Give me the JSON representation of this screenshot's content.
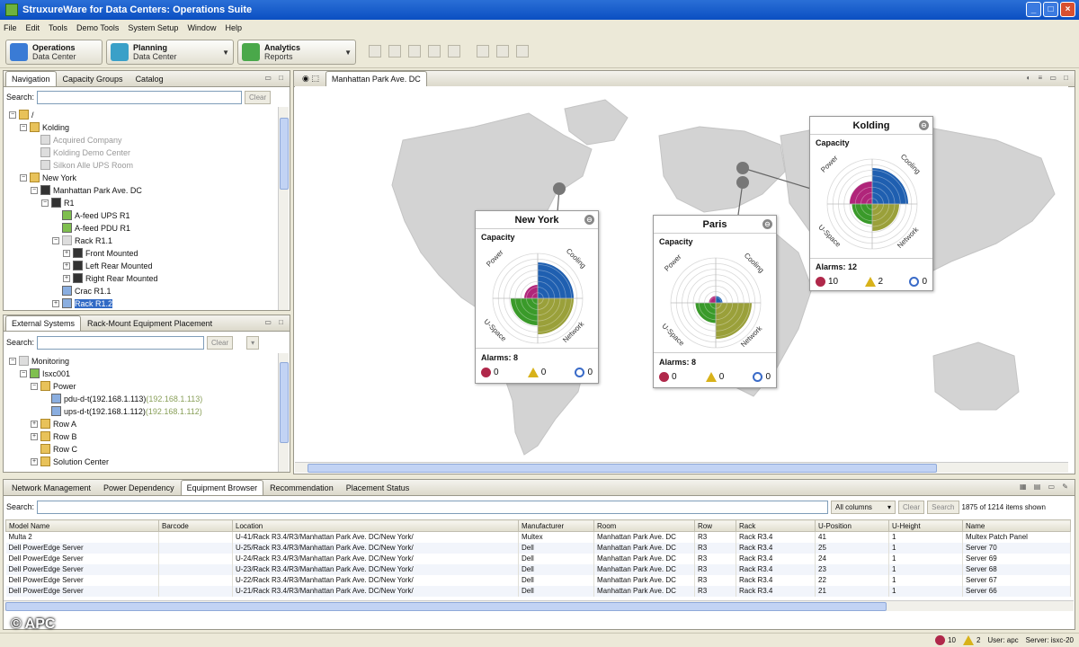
{
  "window": {
    "title": "StruxureWare for Data Centers: Operations Suite"
  },
  "menu": [
    "File",
    "Edit",
    "Tools",
    "Demo Tools",
    "System Setup",
    "Window",
    "Help"
  ],
  "perspectives": [
    {
      "title": "Operations",
      "sub": "Data Center",
      "color": "#3a7bd5"
    },
    {
      "title": "Planning",
      "sub": "Data Center",
      "color": "#3aa0c8"
    },
    {
      "title": "Analytics",
      "sub": "Reports",
      "color": "#4aa84a"
    }
  ],
  "navigation": {
    "tabs": [
      "Navigation",
      "Capacity Groups",
      "Catalog"
    ],
    "search_label": "Search:",
    "clear_label": "Clear",
    "tree": [
      {
        "label": "/",
        "indent": 0,
        "icon": "folder",
        "exp": "−"
      },
      {
        "label": "Kolding",
        "indent": 1,
        "icon": "folder",
        "exp": "−"
      },
      {
        "label": "Acquired Company",
        "indent": 2,
        "icon": "gray",
        "grey": true
      },
      {
        "label": "Kolding Demo Center",
        "indent": 2,
        "icon": "gray",
        "grey": true
      },
      {
        "label": "Silkon Alle UPS Room",
        "indent": 2,
        "icon": "gray",
        "grey": true
      },
      {
        "label": "New York",
        "indent": 1,
        "icon": "folder",
        "exp": "−"
      },
      {
        "label": "Manhattan Park Ave. DC",
        "indent": 2,
        "icon": "dark",
        "exp": "−"
      },
      {
        "label": "R1",
        "indent": 3,
        "icon": "dark",
        "exp": "−"
      },
      {
        "label": "A-feed UPS R1",
        "indent": 4,
        "icon": "green"
      },
      {
        "label": "A-feed PDU R1",
        "indent": 4,
        "icon": "green"
      },
      {
        "label": "Rack R1.1",
        "indent": 4,
        "icon": "gray",
        "exp": "−"
      },
      {
        "label": "Front Mounted",
        "indent": 5,
        "icon": "dark",
        "exp": "+"
      },
      {
        "label": "Left Rear Mounted",
        "indent": 5,
        "icon": "dark",
        "exp": "+"
      },
      {
        "label": "Right Rear Mounted",
        "indent": 5,
        "icon": "dark",
        "exp": "+"
      },
      {
        "label": "Crac R1.1",
        "indent": 4,
        "icon": "blue"
      },
      {
        "label": "Rack R1.2",
        "indent": 4,
        "icon": "blue",
        "sel": true,
        "exp": "+"
      }
    ]
  },
  "external": {
    "tabs": [
      "External Systems",
      "Rack-Mount Equipment Placement"
    ],
    "search_label": "Search:",
    "clear_label": "Clear",
    "tree": [
      {
        "label": "Monitoring",
        "indent": 0,
        "icon": "gray",
        "exp": "−"
      },
      {
        "label": "Isxc001",
        "indent": 1,
        "icon": "green",
        "exp": "−"
      },
      {
        "label": "Power",
        "indent": 2,
        "icon": "folder",
        "exp": "−"
      },
      {
        "label": "pdu-d-t(192.168.1.113)",
        "extra": "(192.168.1.113)",
        "indent": 3,
        "icon": "blue"
      },
      {
        "label": "ups-d-t(192.168.1.112)",
        "extra": "(192.168.1.112)",
        "indent": 3,
        "icon": "blue"
      },
      {
        "label": "Row A",
        "indent": 2,
        "icon": "folder",
        "exp": "+"
      },
      {
        "label": "Row B",
        "indent": 2,
        "icon": "folder",
        "exp": "+"
      },
      {
        "label": "Row C",
        "indent": 2,
        "icon": "folder"
      },
      {
        "label": "Solution Center",
        "indent": 2,
        "icon": "folder",
        "exp": "+"
      }
    ]
  },
  "editor": {
    "tab": "Manhattan Park Ave. DC"
  },
  "sites": [
    {
      "name": "New York",
      "capacity_label": "Capacity",
      "alarms_label": "Alarms: 8",
      "critical": "0",
      "warning": "0",
      "info": "0",
      "axes": {
        "tl": "Power",
        "tr": "Cooling",
        "bl": "U-Space",
        "br": "Network"
      },
      "cap": {
        "power": 0.3,
        "cooling": 0.8,
        "uspace": 0.6,
        "network": 0.8
      }
    },
    {
      "name": "Paris",
      "capacity_label": "Capacity",
      "alarms_label": "Alarms: 8",
      "critical": "0",
      "warning": "0",
      "info": "0",
      "axes": {
        "tl": "Power",
        "tr": "Cooling",
        "bl": "U-Space",
        "br": "Network"
      },
      "cap": {
        "power": 0.15,
        "cooling": 0.15,
        "uspace": 0.45,
        "network": 0.8
      }
    },
    {
      "name": "Kolding",
      "capacity_label": "Capacity",
      "alarms_label": "Alarms: 12",
      "critical": "10",
      "warning": "2",
      "info": "0",
      "axes": {
        "tl": "Power",
        "tr": "Cooling",
        "bl": "U-Space",
        "br": "Network"
      },
      "cap": {
        "power": 0.5,
        "cooling": 0.8,
        "uspace": 0.45,
        "network": 0.6
      }
    }
  ],
  "bottom": {
    "tabs": [
      "Network Management",
      "Power Dependency",
      "Equipment Browser",
      "Recommendation",
      "Placement Status"
    ],
    "search_label": "Search:",
    "column_select": "All columns",
    "clear_label": "Clear",
    "search_btn": "Search",
    "count_text": "1875 of 1214 items shown",
    "columns": [
      "Model Name",
      "Barcode",
      "Location",
      "Manufacturer",
      "Room",
      "Row",
      "Rack",
      "U-Position",
      "U-Height",
      "Name"
    ],
    "rows": [
      [
        "Multa 2",
        "",
        "U-41/Rack R3.4/R3/Manhattan Park Ave. DC/New York/",
        "Multex",
        "Manhattan Park Ave. DC",
        "R3",
        "Rack R3.4",
        "41",
        "1",
        "Multex Patch Panel"
      ],
      [
        "Dell PowerEdge Server",
        "",
        "U-25/Rack R3.4/R3/Manhattan Park Ave. DC/New York/",
        "Dell",
        "Manhattan Park Ave. DC",
        "R3",
        "Rack R3.4",
        "25",
        "1",
        "Server 70"
      ],
      [
        "Dell PowerEdge Server",
        "",
        "U-24/Rack R3.4/R3/Manhattan Park Ave. DC/New York/",
        "Dell",
        "Manhattan Park Ave. DC",
        "R3",
        "Rack R3.4",
        "24",
        "1",
        "Server 69"
      ],
      [
        "Dell PowerEdge Server",
        "",
        "U-23/Rack R3.4/R3/Manhattan Park Ave. DC/New York/",
        "Dell",
        "Manhattan Park Ave. DC",
        "R3",
        "Rack R3.4",
        "23",
        "1",
        "Server 68"
      ],
      [
        "Dell PowerEdge Server",
        "",
        "U-22/Rack R3.4/R3/Manhattan Park Ave. DC/New York/",
        "Dell",
        "Manhattan Park Ave. DC",
        "R3",
        "Rack R3.4",
        "22",
        "1",
        "Server 67"
      ],
      [
        "Dell PowerEdge Server",
        "",
        "U-21/Rack R3.4/R3/Manhattan Park Ave. DC/New York/",
        "Dell",
        "Manhattan Park Ave. DC",
        "R3",
        "Rack R3.4",
        "21",
        "1",
        "Server 66"
      ]
    ]
  },
  "status": {
    "critical": "10",
    "warning": "2",
    "user": "User: apc",
    "server": "Server: isxc-20"
  },
  "watermark": "© APC",
  "colors": {
    "power": "#b0257a",
    "cooling": "#1f5fb0",
    "uspace": "#3a9a2a",
    "network": "#9aa03a"
  }
}
